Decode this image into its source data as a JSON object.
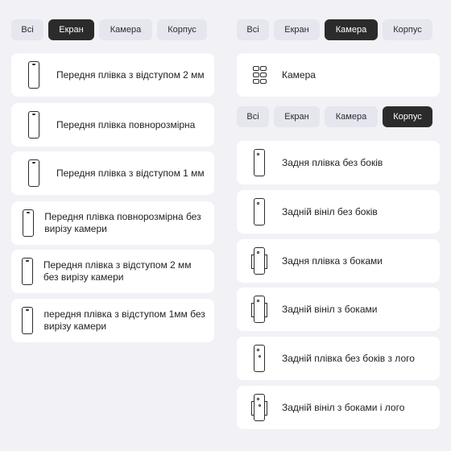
{
  "tabs_labels": {
    "all": "Всі",
    "screen": "Екран",
    "camera": "Камера",
    "body": "Корпус"
  },
  "left": {
    "items": [
      {
        "label": "Передня плівка з відступом 2 мм",
        "icon": "phone-front-icon"
      },
      {
        "label": "Передня плівка повнорозмірна",
        "icon": "phone-front-icon"
      },
      {
        "label": "Передня плівка з відступом 1 мм",
        "icon": "phone-front-icon"
      },
      {
        "label": "Передня плівка повнорозмірна без вирізу камери",
        "icon": "phone-front-icon"
      },
      {
        "label": "Передня плівка з відступом 2 мм без вирізу камери",
        "icon": "phone-front-icon"
      },
      {
        "label": "передня плівка з відступом 1мм без вирізу камери",
        "icon": "phone-front-icon"
      }
    ]
  },
  "right": {
    "camera_item": {
      "label": "Камера",
      "icon": "camera-lenses-icon"
    },
    "items": [
      {
        "label": "Задня плівка без боків",
        "icon": "phone-back-icon"
      },
      {
        "label": "Задній вініл без боків",
        "icon": "phone-back-icon"
      },
      {
        "label": "Задня плівка з боками",
        "icon": "phone-back-sides-icon"
      },
      {
        "label": "Задній вініл з боками",
        "icon": "phone-back-sides-icon"
      },
      {
        "label": "Задній плівка без боків з лого",
        "icon": "phone-back-logo-icon"
      },
      {
        "label": "Задній вініл з боками і лого",
        "icon": "phone-back-sides-logo-icon"
      }
    ]
  },
  "colors": {
    "background": "#f1f1f6",
    "tab": "#e6e6ef",
    "tab_active": "#2b2b2b",
    "card": "#ffffff"
  }
}
